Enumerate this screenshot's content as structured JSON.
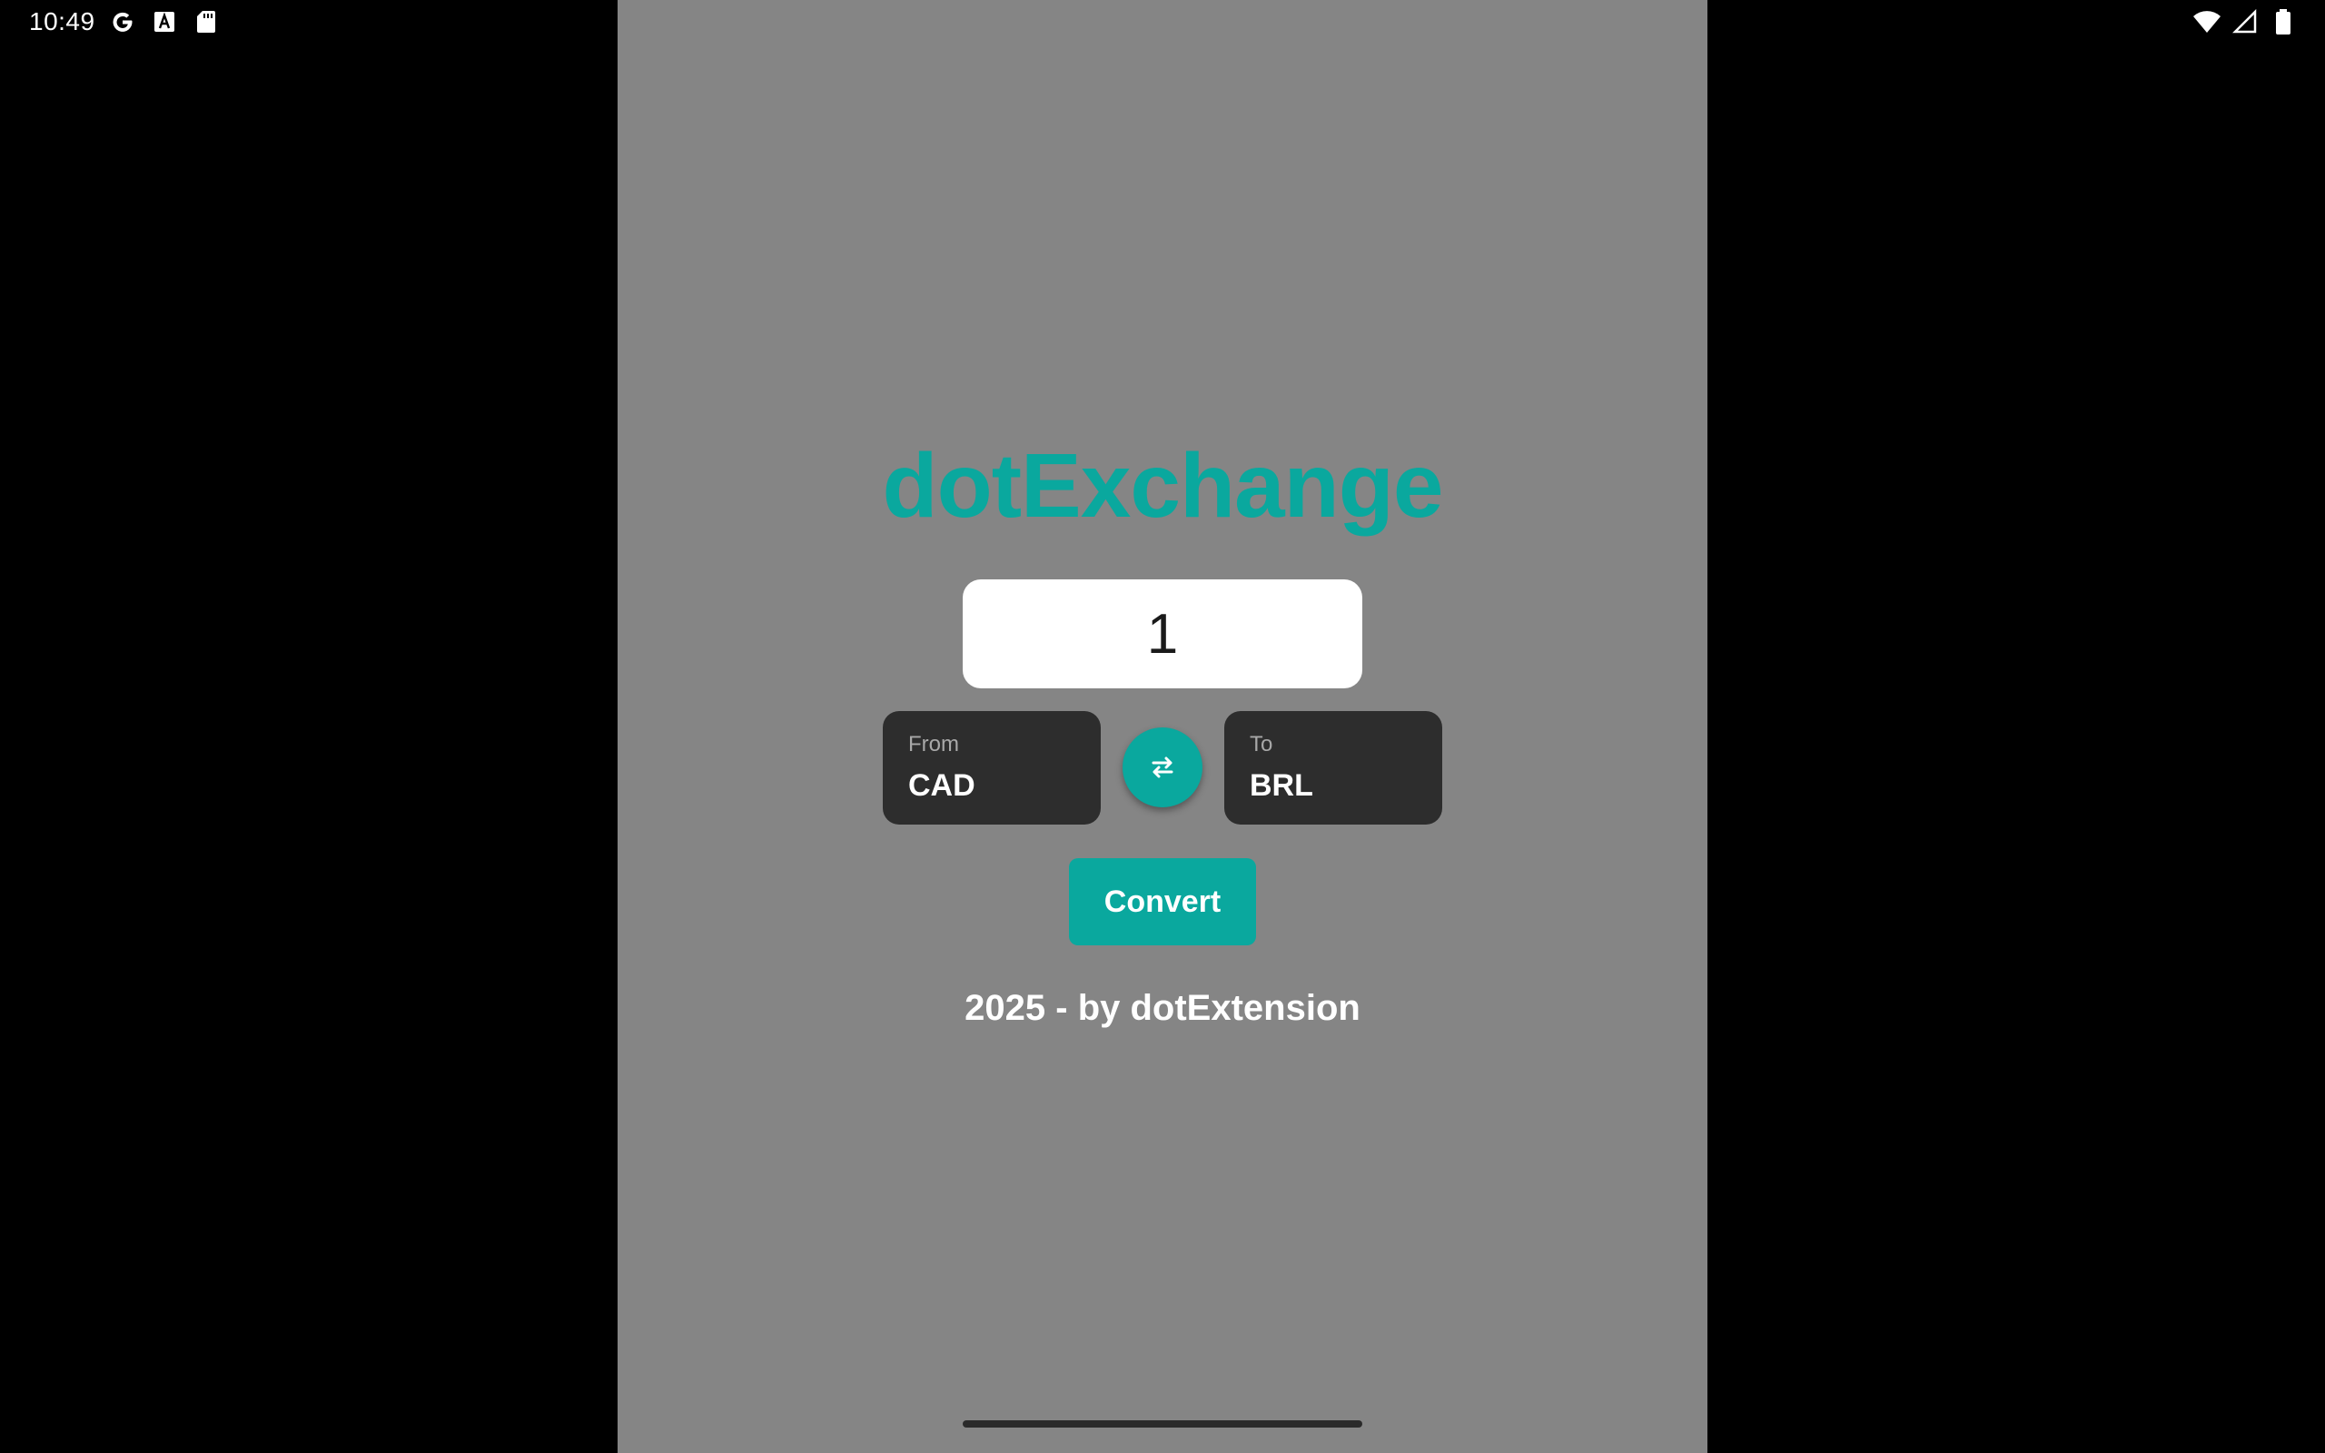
{
  "status_bar": {
    "time": "10:49",
    "left_icons": [
      "google-g-icon",
      "font-a-icon",
      "sd-card-icon"
    ],
    "right_icons": [
      "wifi-icon",
      "cell-signal-icon",
      "battery-icon"
    ]
  },
  "app": {
    "title": "dotExchange",
    "amount": {
      "value": "1",
      "placeholder": ""
    },
    "from": {
      "label": "From",
      "currency": "CAD"
    },
    "to": {
      "label": "To",
      "currency": "BRL"
    },
    "swap_icon": "swap-arrows-icon",
    "convert_label": "Convert",
    "footer": "2025 - by dotExtension"
  },
  "colors": {
    "accent": "#0aa89e",
    "background": "#858585",
    "card": "#2d2d2d",
    "outer": "#000000"
  }
}
